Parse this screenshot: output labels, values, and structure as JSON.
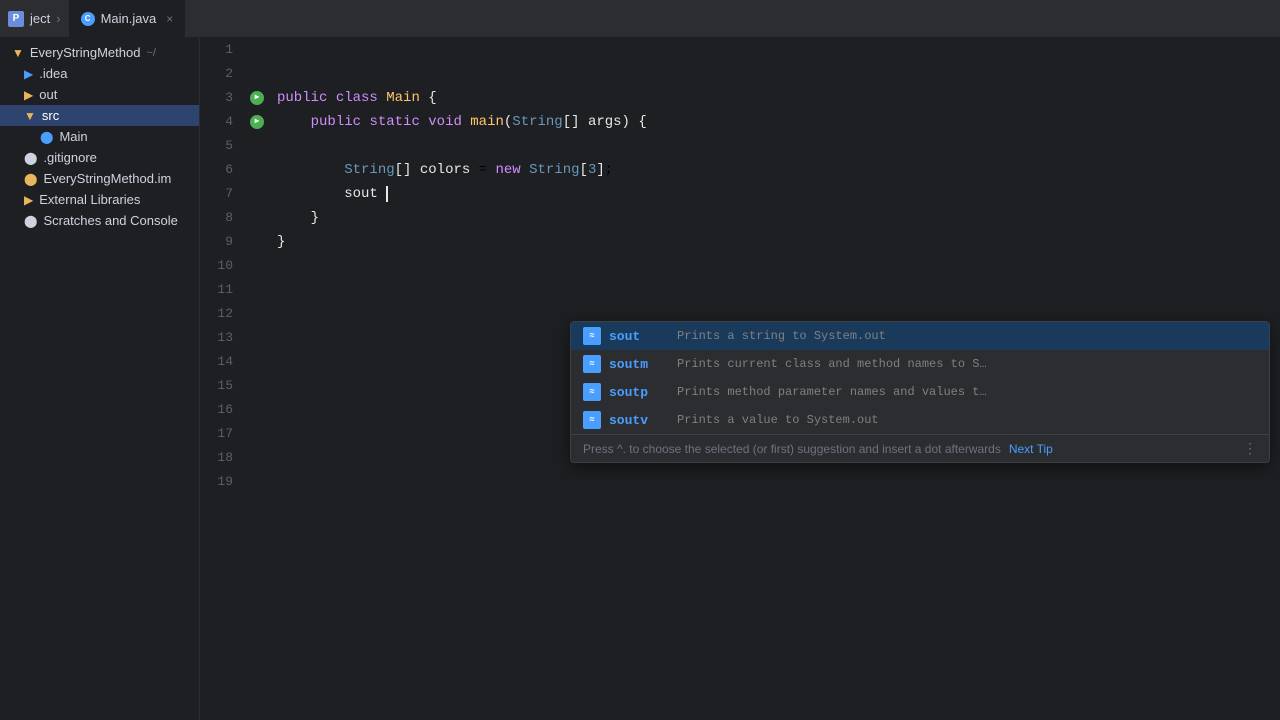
{
  "titlebar": {
    "project_label": "ject",
    "chevron": "›"
  },
  "tab": {
    "label": "Main.java",
    "icon_text": "C",
    "close": "×"
  },
  "sidebar": {
    "items": [
      {
        "id": "project",
        "label": "EveryStringMethod",
        "suffix": "~/",
        "icon": "folder",
        "indent": 0
      },
      {
        "id": "idea",
        "label": ".idea",
        "icon": "idea",
        "indent": 1
      },
      {
        "id": "out",
        "label": "out",
        "icon": "folder",
        "indent": 1,
        "selected": false
      },
      {
        "id": "src",
        "label": "src",
        "icon": "folder",
        "indent": 1,
        "selected": true
      },
      {
        "id": "main",
        "label": "Main",
        "icon": "java",
        "indent": 2
      },
      {
        "id": "gitignore",
        "label": ".gitignore",
        "icon": "git",
        "indent": 1
      },
      {
        "id": "iml",
        "label": "EveryStringMethod.im",
        "icon": "iml",
        "indent": 1
      },
      {
        "id": "external",
        "label": "External Libraries",
        "icon": "folder",
        "indent": 1
      },
      {
        "id": "scratches",
        "label": "Scratches and Console",
        "icon": "scratch",
        "indent": 1
      }
    ]
  },
  "code": {
    "lines": [
      {
        "num": 1,
        "content": "",
        "run": false
      },
      {
        "num": 2,
        "content": "",
        "run": false
      },
      {
        "num": 3,
        "content": "public class Main {",
        "run": true
      },
      {
        "num": 4,
        "content": "    public static void main(String[] args) {",
        "run": true
      },
      {
        "num": 5,
        "content": "",
        "run": false
      },
      {
        "num": 6,
        "content": "        String[] colors = new String[3];",
        "run": false
      },
      {
        "num": 7,
        "content": "        sout",
        "run": false,
        "cursor": true
      },
      {
        "num": 8,
        "content": "    }",
        "run": false
      },
      {
        "num": 9,
        "content": "}",
        "run": false
      },
      {
        "num": 10,
        "content": "",
        "run": false
      },
      {
        "num": 11,
        "content": "",
        "run": false
      },
      {
        "num": 12,
        "content": "",
        "run": false
      },
      {
        "num": 13,
        "content": "",
        "run": false
      },
      {
        "num": 14,
        "content": "",
        "run": false
      },
      {
        "num": 15,
        "content": "",
        "run": false
      },
      {
        "num": 16,
        "content": "",
        "run": false
      },
      {
        "num": 17,
        "content": "",
        "run": false
      },
      {
        "num": 18,
        "content": "",
        "run": false
      },
      {
        "num": 19,
        "content": "",
        "run": false
      }
    ]
  },
  "autocomplete": {
    "items": [
      {
        "id": "sout",
        "name": "sout",
        "desc": "Prints a string to System.out",
        "selected": true
      },
      {
        "id": "soutm",
        "name": "soutm",
        "desc": "Prints current class and method names to S…"
      },
      {
        "id": "soutp",
        "name": "soutp",
        "desc": "Prints method parameter names and values t…"
      },
      {
        "id": "soutv",
        "name": "soutv",
        "desc": "Prints a value to System.out"
      }
    ],
    "footer_text": "Press ^. to choose the selected (or first) suggestion and insert a dot afterwards",
    "next_tip_label": "Next Tip",
    "more_icon": "⋮"
  }
}
